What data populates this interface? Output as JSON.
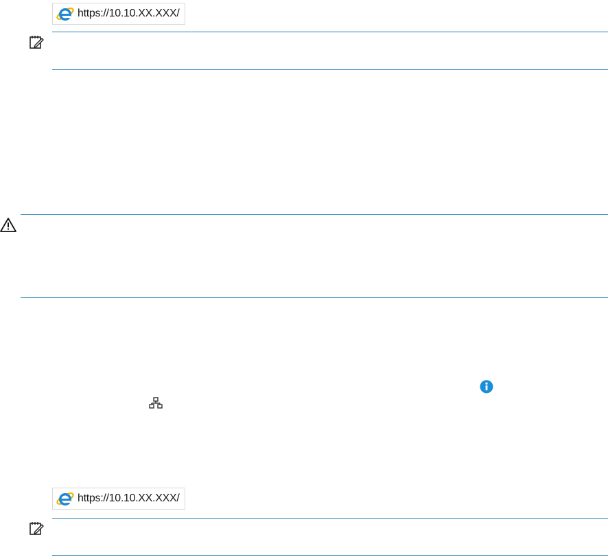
{
  "top_step": {
    "address_bar": {
      "url": "https://10.10.XX.XXX/",
      "icon": "internet-explorer-icon"
    },
    "note_icon": "note-icon"
  },
  "caution": {
    "icon": "warning-triangle-icon"
  },
  "steps": {
    "info_icon": "info-icon",
    "network_icon": "network-icon"
  },
  "bottom_step": {
    "address_bar": {
      "url": "https://10.10.XX.XXX/",
      "icon": "internet-explorer-icon"
    },
    "note_icon": "note-icon"
  },
  "colors": {
    "rule": "#2c7fb8",
    "info_blue": "#1a8fd8",
    "ie_blue": "#1e88d6",
    "ie_yellow": "#f5b400"
  }
}
